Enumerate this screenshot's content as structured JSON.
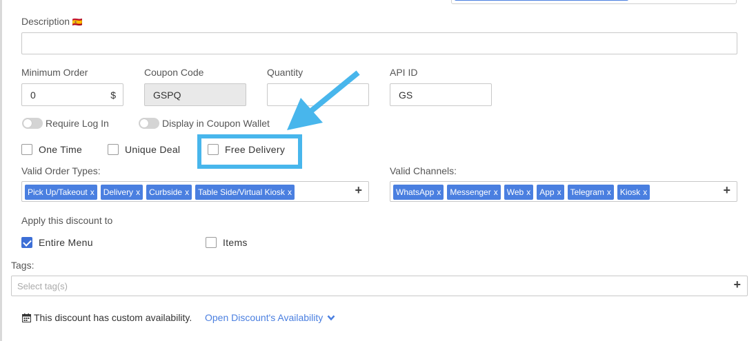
{
  "description": {
    "label": "Description",
    "flag": "🇪🇸",
    "value": ""
  },
  "fields": {
    "minimum_order": {
      "label": "Minimum Order",
      "value": "0",
      "suffix": "$"
    },
    "coupon_code": {
      "label": "Coupon Code",
      "value": "GSPQ"
    },
    "quantity": {
      "label": "Quantity",
      "value": ""
    },
    "api_id": {
      "label": "API ID",
      "value": "GS"
    }
  },
  "toggles": {
    "require_login": {
      "label": "Require Log In",
      "on": false
    },
    "display_wallet": {
      "label": "Display in Coupon Wallet",
      "on": false
    }
  },
  "checkboxes": {
    "one_time": {
      "label": "One Time",
      "checked": false
    },
    "unique_deal": {
      "label": "Unique Deal",
      "checked": false
    },
    "free_delivery": {
      "label": "Free Delivery",
      "checked": false
    }
  },
  "order_types": {
    "label": "Valid Order Types:",
    "tags": [
      "Pick Up/Takeout",
      "Delivery",
      "Curbside",
      "Table Side/Virtual Kiosk"
    ]
  },
  "channels": {
    "label": "Valid Channels:",
    "tags": [
      "WhatsApp",
      "Messenger",
      "Web",
      "App",
      "Telegram",
      "Kiosk"
    ]
  },
  "apply": {
    "label": "Apply this discount to",
    "entire_menu": {
      "label": "Entire Menu",
      "checked": true
    },
    "items": {
      "label": "Items",
      "checked": false
    }
  },
  "tags": {
    "label": "Tags:",
    "placeholder": "Select tag(s)"
  },
  "availability": {
    "text": "This discount has custom availability.",
    "link": "Open Discount's Availability"
  },
  "chip_remove": "x",
  "add_glyph": "+",
  "colors": {
    "accent": "#4a7fe0",
    "highlight": "#48b6ec",
    "checked": "#3d6fd6"
  }
}
